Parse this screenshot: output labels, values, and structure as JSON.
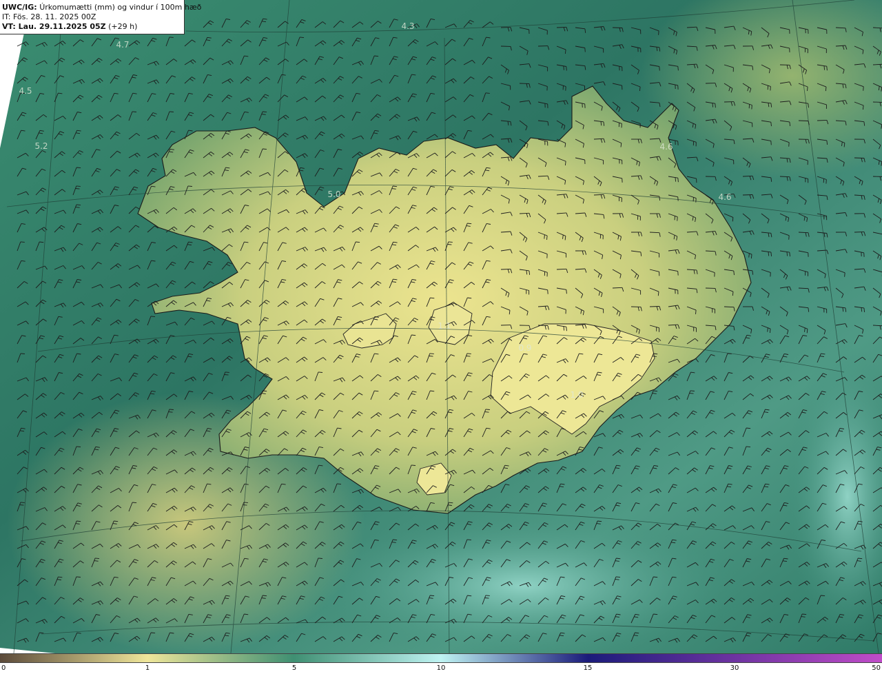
{
  "header": {
    "model": "UWC/IG:",
    "title": "Úrkomumætti (mm) og vindur í 100m hæð",
    "init_time": "IT: Fös. 28. 11. 2025 00Z",
    "valid_label": "VT: Lau. 29.11.2025 05Z",
    "valid_offset": "(+29 h)"
  },
  "map_labels": [
    {
      "id": "lbl-1",
      "text": "4.3"
    },
    {
      "id": "lbl-2",
      "text": "4.7"
    },
    {
      "id": "lbl-3",
      "text": "4.5"
    },
    {
      "id": "lbl-4",
      "text": "5.2"
    },
    {
      "id": "lbl-5",
      "text": "5.0"
    },
    {
      "id": "lbl-6",
      "text": "4.6"
    },
    {
      "id": "lbl-7",
      "text": "4.6"
    },
    {
      "id": "lbl-8",
      "text": "1.1"
    },
    {
      "id": "lbl-9",
      "text": "0.9"
    },
    {
      "id": "lbl-10",
      "text": "1.0"
    }
  ],
  "colorbar": {
    "ticks": [
      "0",
      "1",
      "5",
      "10",
      "15",
      "30",
      "50"
    ],
    "colors": {
      "dry": "#5b4a3a",
      "low": "#efe69a",
      "mid": "#3f8f72",
      "high": "#bff3f2",
      "very_high": "#1b1b7a",
      "extreme": "#c04cc8"
    }
  },
  "map_colors": {
    "sea": "#2f7a67",
    "land_low": "#e6e08e",
    "land_mid": "#8fb36e",
    "coast": "#1a1a1a"
  }
}
